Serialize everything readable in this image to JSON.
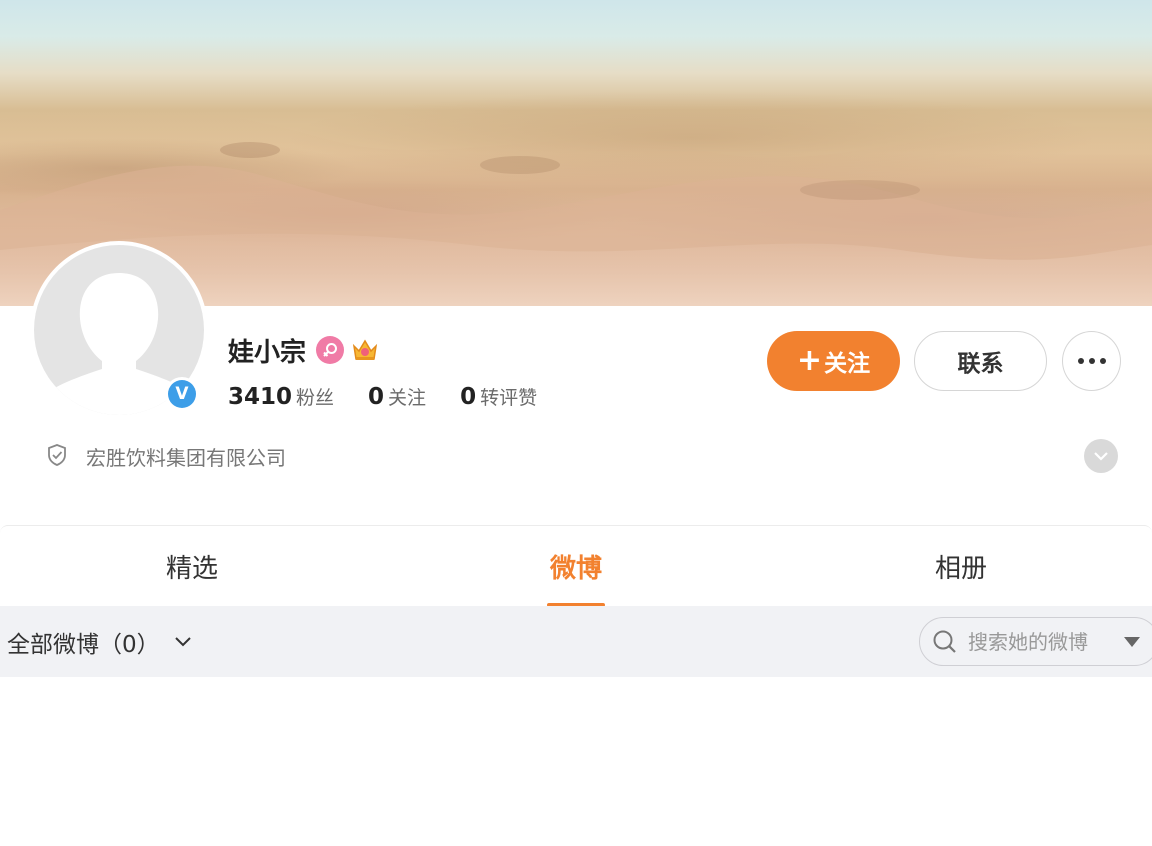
{
  "profile": {
    "name": "娃小宗",
    "gender_icon": "female-icon",
    "vip_icon": "crown-icon",
    "verified": true,
    "verified_mark": "V"
  },
  "stats": [
    {
      "value": "3410",
      "label": "粉丝"
    },
    {
      "value": "0",
      "label": "关注"
    },
    {
      "value": "0",
      "label": "转评赞"
    }
  ],
  "actions": {
    "follow_plus": "+",
    "follow_label": "关注",
    "contact_label": "联系",
    "more_icon": "more-dots-icon"
  },
  "company": {
    "text": "宏胜饮料集团有限公司",
    "icon": "shield-check-icon"
  },
  "tabs": [
    {
      "label": "精选",
      "active": false
    },
    {
      "label": "微博",
      "active": true
    },
    {
      "label": "相册",
      "active": false
    }
  ],
  "filter": {
    "label": "全部微博（0）",
    "search_placeholder": "搜索她的微博"
  },
  "colors": {
    "accent": "#f2812f",
    "verified": "#3d9ee8",
    "female": "#f07ba6"
  }
}
